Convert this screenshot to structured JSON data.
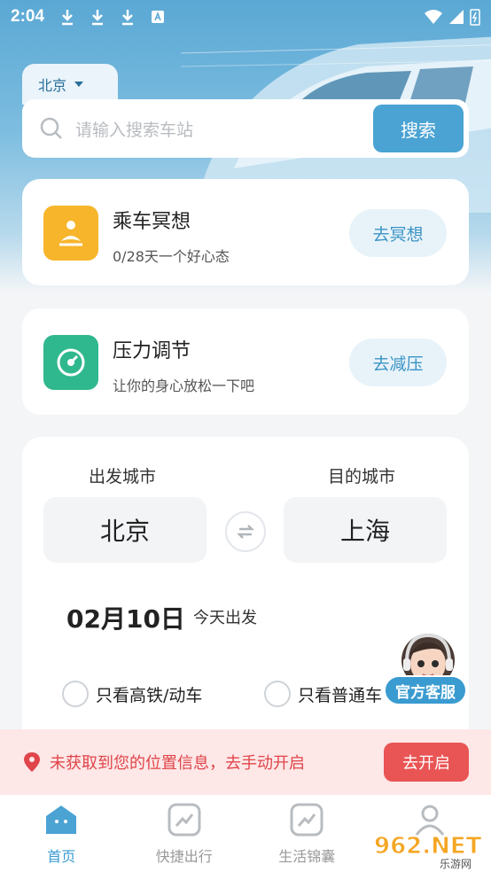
{
  "status_bar": {
    "time": "2:04"
  },
  "search": {
    "city": "北京",
    "placeholder": "请输入搜索车站",
    "button": "搜索"
  },
  "cards": [
    {
      "title": "乘车冥想",
      "subtitle": "0/28天一个好心态",
      "button": "去冥想",
      "icon": "meditation-icon",
      "color": "#f7b52c"
    },
    {
      "title": "压力调节",
      "subtitle": "让你的身心放松一下吧",
      "button": "去减压",
      "icon": "gauge-icon",
      "color": "#2fb88d"
    }
  ],
  "route": {
    "from_label": "出发城市",
    "to_label": "目的城市",
    "from_city": "北京",
    "to_city": "上海",
    "date": "02月10日",
    "date_sub": "今天出发",
    "filter_high_speed": "只看高铁/动车",
    "filter_normal": "只看普通车"
  },
  "agent": {
    "label": "官方客服"
  },
  "location_bar": {
    "message": "未获取到您的位置信息，去手动开启",
    "button": "去开启"
  },
  "tabs": [
    {
      "label": "首页",
      "icon": "home-icon",
      "active": true
    },
    {
      "label": "快捷出行",
      "icon": "trend-icon",
      "active": false
    },
    {
      "label": "生活锦囊",
      "icon": "trend-icon",
      "active": false
    },
    {
      "label": "",
      "icon": "user-icon",
      "active": false
    }
  ],
  "watermark": {
    "text": "962.NET",
    "sub": "乐游网"
  },
  "colors": {
    "accent": "#4aa3d3",
    "danger": "#e95454"
  }
}
